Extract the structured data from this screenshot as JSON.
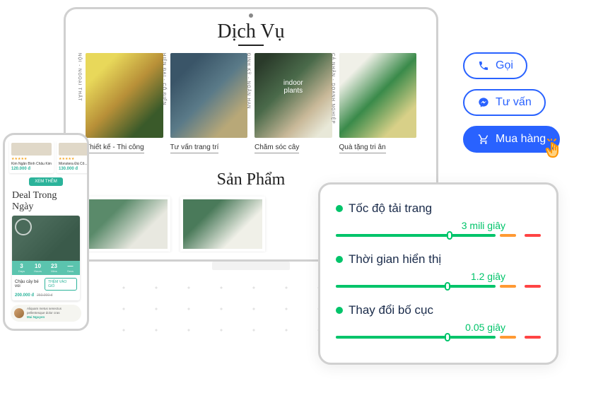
{
  "desktop": {
    "section1_title": "Dịch Vụ",
    "services": [
      {
        "vert": "NỘI - NGOẠI THẤT",
        "name": "Thiết kế - Thi công"
      },
      {
        "vert": "HIỆN ĐẠI - CỔ ĐIỂN",
        "name": "Tư vấn trang trí"
      },
      {
        "vert": "ĐỊNH KỲ - NGẮN HẠN",
        "name": "Chăm sóc cây"
      },
      {
        "vert": "CÁ NHÂN - DOANH NGHIỆP",
        "name": "Quà tặng tri ân"
      }
    ],
    "section2_title": "Sản Phẩm"
  },
  "phone": {
    "cards": [
      {
        "name": "Kim Ngân Bình Châu Kim",
        "price": "120.000 đ"
      },
      {
        "name": "Monstera Đá Cổ...",
        "price": "130.000 đ"
      }
    ],
    "more_btn": "XEM THÊM",
    "deal_title": "Deal Trong Ngày",
    "countdown": [
      {
        "n": "3",
        "l": "Days"
      },
      {
        "n": "10",
        "l": "Hours"
      },
      {
        "n": "23",
        "l": "Mins"
      },
      {
        "n": "—",
        "l": "Secs"
      }
    ],
    "deal_name": "Chậu cây bé voi",
    "deal_btn": "THÊM VÀO GIỎ",
    "price_now": "200.000 đ",
    "price_old": "250.000 đ",
    "chat": {
      "text": "Aliquam metus senectus pellentesque dolor cras",
      "name": "Mai Nguyen"
    }
  },
  "tablet": {
    "metrics": [
      {
        "title": "Tốc độ tải trang",
        "value": "3 mili giây",
        "marker_pct": 54
      },
      {
        "title": "Thời gian hiển thị",
        "value": "1.2 giây",
        "marker_pct": 53
      },
      {
        "title": "Thay đổi bố cục",
        "value": "0.05 giây",
        "marker_pct": 53
      }
    ]
  },
  "cta": {
    "call": "Gọi",
    "consult": "Tư vấn",
    "buy": "Mua hàng"
  }
}
